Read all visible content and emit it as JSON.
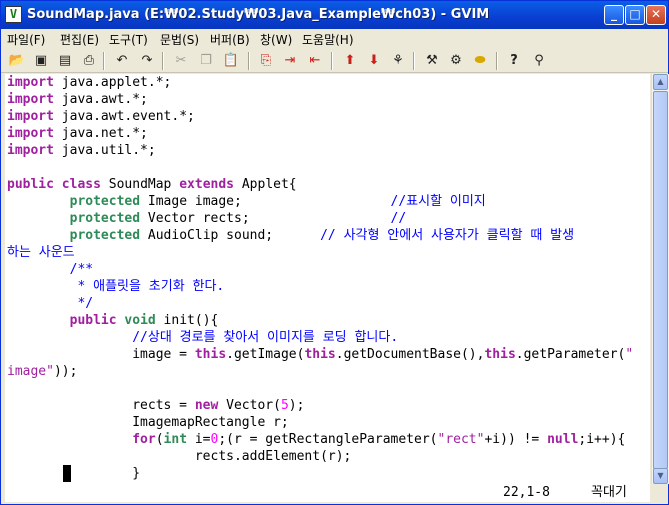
{
  "window": {
    "title": "SoundMap.java (E:₩02.Study₩03.Java_Example₩ch03) - GVIM",
    "icon_letter": "V"
  },
  "title_buttons": {
    "minimize": "_",
    "maximize": "□",
    "close": "✕"
  },
  "menu": [
    "파일(F)",
    "편집(E)",
    "도구(T)",
    "문법(S)",
    "버퍼(B)",
    "창(W)",
    "도움말(H)"
  ],
  "toolbar_icons": [
    "open-icon",
    "save-icon",
    "save-all-icon",
    "print-icon",
    "undo-icon",
    "redo-icon",
    "cut-icon",
    "copy-icon",
    "paste-icon",
    "find-replace-icon",
    "find-next-icon",
    "find-prev-icon",
    "load-session-icon",
    "save-session-icon",
    "run-script-icon",
    "make-icon",
    "run-shell-icon",
    "find-tag-icon",
    "help-icon",
    "find-help-icon"
  ],
  "code_lines": [
    [
      {
        "c": "kw",
        "t": "import"
      },
      {
        "c": "",
        "t": " java.applet.*;"
      }
    ],
    [
      {
        "c": "kw",
        "t": "import"
      },
      {
        "c": "",
        "t": " java.awt.*;"
      }
    ],
    [
      {
        "c": "kw",
        "t": "import"
      },
      {
        "c": "",
        "t": " java.awt.event.*;"
      }
    ],
    [
      {
        "c": "kw",
        "t": "import"
      },
      {
        "c": "",
        "t": " java.net.*;"
      }
    ],
    [
      {
        "c": "kw",
        "t": "import"
      },
      {
        "c": "",
        "t": " java.util.*;"
      }
    ],
    [],
    [
      {
        "c": "kw",
        "t": "public"
      },
      {
        "c": "",
        "t": " "
      },
      {
        "c": "kw",
        "t": "class"
      },
      {
        "c": "",
        "t": " SoundMap "
      },
      {
        "c": "kw",
        "t": "extends"
      },
      {
        "c": "",
        "t": " Applet{"
      }
    ],
    [
      {
        "c": "",
        "t": "        "
      },
      {
        "c": "ty",
        "t": "protected"
      },
      {
        "c": "",
        "t": " Image image;                   "
      },
      {
        "c": "cm",
        "t": "//표시할 이미지"
      }
    ],
    [
      {
        "c": "",
        "t": "        "
      },
      {
        "c": "ty",
        "t": "protected"
      },
      {
        "c": "",
        "t": " Vector rects;                  "
      },
      {
        "c": "cm",
        "t": "//"
      }
    ],
    [
      {
        "c": "",
        "t": "        "
      },
      {
        "c": "ty",
        "t": "protected"
      },
      {
        "c": "",
        "t": " AudioClip sound;      "
      },
      {
        "c": "cm",
        "t": "// 사각형 안에서 사용자가 클릭할 때 발생"
      }
    ],
    [
      {
        "c": "cm",
        "t": "하는 사운드"
      }
    ],
    [
      {
        "c": "",
        "t": "        "
      },
      {
        "c": "cm",
        "t": "/**"
      }
    ],
    [
      {
        "c": "",
        "t": "         "
      },
      {
        "c": "cm",
        "t": "* 애플릿을 초기화 한다."
      }
    ],
    [
      {
        "c": "",
        "t": "         "
      },
      {
        "c": "cm",
        "t": "*/"
      }
    ],
    [
      {
        "c": "",
        "t": "        "
      },
      {
        "c": "kw",
        "t": "public"
      },
      {
        "c": "",
        "t": " "
      },
      {
        "c": "ty",
        "t": "void"
      },
      {
        "c": "",
        "t": " init(){"
      }
    ],
    [
      {
        "c": "",
        "t": "                "
      },
      {
        "c": "cm",
        "t": "//상대 경로를 찾아서 이미지를 로딩 합니다."
      }
    ],
    [
      {
        "c": "",
        "t": "                image = "
      },
      {
        "c": "kw",
        "t": "this"
      },
      {
        "c": "",
        "t": ".getImage("
      },
      {
        "c": "kw",
        "t": "this"
      },
      {
        "c": "",
        "t": ".getDocumentBase(),"
      },
      {
        "c": "kw",
        "t": "this"
      },
      {
        "c": "",
        "t": ".getParameter("
      },
      {
        "c": "st",
        "t": "\""
      }
    ],
    [
      {
        "c": "st",
        "t": "image\""
      },
      {
        "c": "",
        "t": "));"
      }
    ],
    [],
    [
      {
        "c": "",
        "t": "                rects = "
      },
      {
        "c": "kw",
        "t": "new"
      },
      {
        "c": "",
        "t": " Vector("
      },
      {
        "c": "nm",
        "t": "5"
      },
      {
        "c": "",
        "t": ");"
      }
    ],
    [
      {
        "c": "",
        "t": "                ImagemapRectangle r;"
      }
    ],
    [
      {
        "c": "",
        "t": "                "
      },
      {
        "c": "kw",
        "t": "for"
      },
      {
        "c": "",
        "t": "("
      },
      {
        "c": "ty",
        "t": "int"
      },
      {
        "c": "",
        "t": " i="
      },
      {
        "c": "nm",
        "t": "0"
      },
      {
        "c": "",
        "t": ";(r = getRectangleParameter("
      },
      {
        "c": "st",
        "t": "\"rect\""
      },
      {
        "c": "",
        "t": "+i)) != "
      },
      {
        "c": "kw",
        "t": "null"
      },
      {
        "c": "",
        "t": ";i++){"
      }
    ],
    [
      {
        "c": "",
        "t": "                        rects.addElement(r);"
      }
    ],
    [
      {
        "c": "",
        "t": "                }"
      }
    ]
  ],
  "status": {
    "position": "22,1-8",
    "scroll": "꼭대기"
  }
}
